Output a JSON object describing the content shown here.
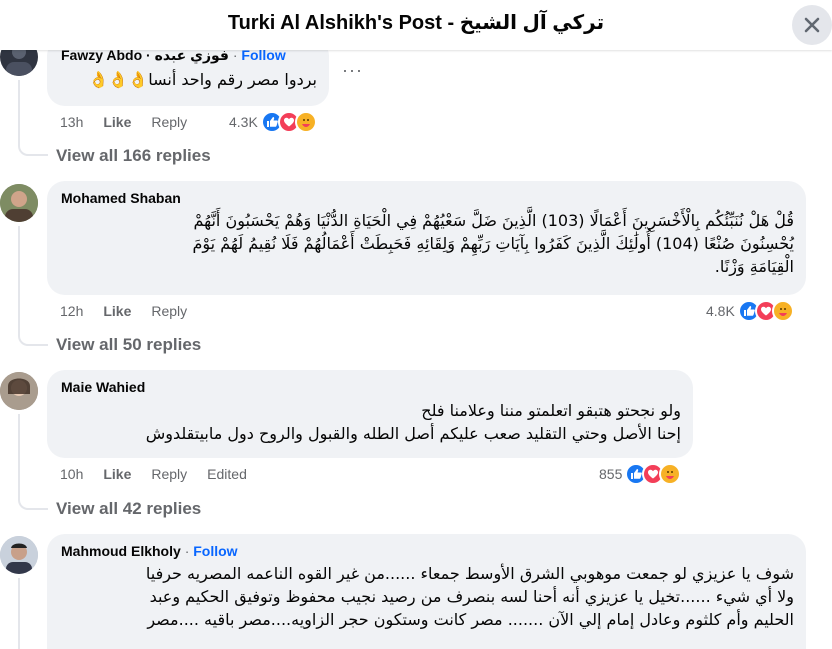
{
  "header": {
    "title": "Turki Al Alshikh's Post - تركي آل الشيخ"
  },
  "comments": [
    {
      "author": "Fawzy Abdo · فوزي عبده",
      "follow": "Follow",
      "text": "بردوا مصر رقم واحد أنسا👌👌👌",
      "time": "13h",
      "like": "Like",
      "reply": "Reply",
      "edited": "",
      "react_count": "4.3K",
      "view_replies": "View all 166 replies"
    },
    {
      "author": "Mohamed Shaban",
      "follow": "",
      "text_lines": [
        "قُلْ هَلْ نُنَبِّئُكُم بِالْأَخْسَرِينَ أَعْمَالًا (103) الَّذِينَ ضَلَّ سَعْيُهُمْ فِي الْحَيَاةِ الدُّنْيَا وَهُمْ يَحْسَبُونَ أَنَّهُمْ",
        "يُحْسِنُونَ صُنْعًا (104) أُولَٰئِكَ الَّذِينَ كَفَرُوا بِآيَاتِ رَبِّهِمْ وَلِقَائِهِ فَحَبِطَتْ أَعْمَالُهُمْ فَلَا نُقِيمُ لَهُمْ يَوْمَ",
        "الْقِيَامَةِ وَزْنًا."
      ],
      "time": "12h",
      "like": "Like",
      "reply": "Reply",
      "edited": "",
      "react_count": "4.8K",
      "view_replies": "View all 50 replies"
    },
    {
      "author": "Maie Wahied",
      "follow": "",
      "text_lines": [
        "ولو نجحتو هتبقو اتعلمتو مننا وعلامنا فلح",
        "إحنا الأصل وحتي التقليد صعب عليكم أصل الطله والقبول والروح دول مابيتقلدوش"
      ],
      "time": "10h",
      "like": "Like",
      "reply": "Reply",
      "edited": "Edited",
      "react_count": "855",
      "view_replies": "View all 42 replies"
    },
    {
      "author": "Mahmoud Elkholy",
      "follow": "Follow",
      "text_lines": [
        "شوف يا عزيزي لو جمعت موهوبي الشرق الأوسط جمعاء ......من غير القوه الناعمه المصريه حرفيا",
        "ولا أي شيء ......تخيل يا عزيزي أنه أحنا لسه بنصرف من رصيد نجيب محفوظ وتوفيق الحكيم وعبد",
        "الحليم وأم كلثوم وعادل إمام إلي الآن ....... مصر كانت وستكون حجر الزاويه....مصر باقيه ....مصر"
      ]
    }
  ],
  "colors": {
    "accent": "#0866ff",
    "like": "#1877f2",
    "love": "#f33e58",
    "care": "#f7b125",
    "bubble": "#f0f2f5"
  },
  "icons": {
    "close": "close-icon",
    "like": "like-reaction-icon",
    "love": "love-reaction-icon",
    "care": "care-reaction-icon",
    "more": "more-options-icon"
  }
}
